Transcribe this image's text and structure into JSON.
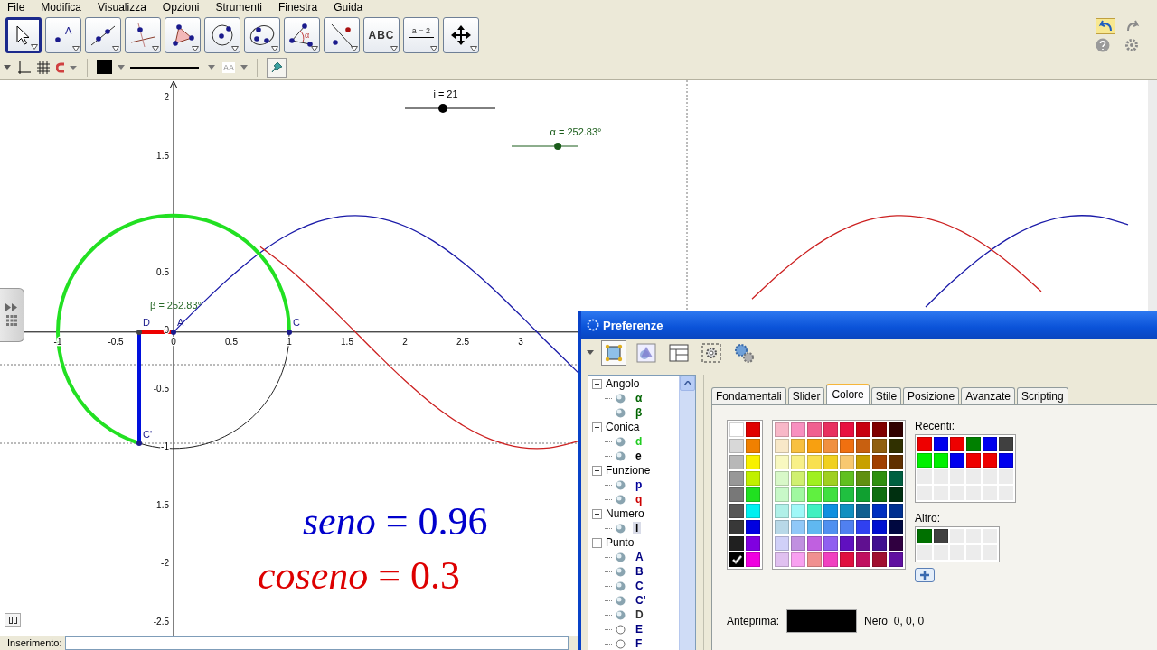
{
  "menu": [
    "File",
    "Modifica",
    "Visualizza",
    "Opzioni",
    "Strumenti",
    "Finestra",
    "Guida"
  ],
  "tools": [
    {
      "kind": "move",
      "selected": true
    },
    {
      "kind": "point",
      "label": "A",
      "selected": false
    },
    {
      "kind": "line",
      "selected": false
    },
    {
      "kind": "perpendicular",
      "selected": false
    },
    {
      "kind": "polygon",
      "selected": false
    },
    {
      "kind": "circle",
      "selected": false
    },
    {
      "kind": "conic",
      "selected": false
    },
    {
      "kind": "angle",
      "label": "α",
      "selected": false
    },
    {
      "kind": "reflect",
      "selected": false
    },
    {
      "kind": "text",
      "label": "ABC",
      "selected": false
    },
    {
      "kind": "slider",
      "label": "a = 2",
      "selected": false
    },
    {
      "kind": "pan",
      "selected": false
    }
  ],
  "style_bar": {
    "label_style": "AA"
  },
  "graphics": {
    "sliders": [
      {
        "label": "i = 21",
        "level": 0.42,
        "color": "#000000"
      },
      {
        "label": "α = 252.83°",
        "level": 0.7,
        "color": "#1a5c1a"
      }
    ],
    "chart_data": {
      "type": "line",
      "x": [
        0,
        0.25,
        0.5,
        0.75,
        1,
        1.25,
        1.5,
        1.75,
        2,
        2.25,
        2.5,
        2.75,
        3,
        3.25,
        3.5,
        3.75,
        4,
        4.25,
        4.5,
        4.75,
        5,
        5.25,
        5.5,
        5.75,
        6,
        6.25,
        6.5,
        6.75,
        7,
        7.25,
        7.5,
        7.75,
        8,
        8.25
      ],
      "series": [
        {
          "color": "#1a1aa8",
          "values": [
            0,
            0.247,
            0.479,
            0.682,
            0.841,
            0.949,
            0.997,
            0.984,
            0.909,
            0.778,
            0.598,
            0.382,
            0.141,
            -0.108,
            -0.351,
            null,
            null,
            null,
            null,
            null,
            null,
            null,
            null,
            null,
            null,
            null,
            0.215,
            0.451,
            0.657,
            0.823,
            0.938,
            0.995,
            0.989,
            0.922
          ]
        },
        {
          "color": "#cc2020",
          "values": [
            null,
            null,
            null,
            0.732,
            0.54,
            0.315,
            0.071,
            -0.178,
            -0.416,
            -0.628,
            -0.801,
            -0.924,
            -0.99,
            -0.994,
            -0.936,
            null,
            null,
            null,
            null,
            null,
            0.284,
            0.512,
            0.709,
            0.861,
            0.96,
            0.999,
            0.977,
            0.893,
            0.754,
            0.568,
            0.347,
            null,
            null,
            null
          ]
        }
      ],
      "xlim": [
        -1.5,
        8.5
      ],
      "ylim": [
        -2.62,
        2.16
      ],
      "xticks": [
        {
          "value": -1,
          "label": "-1"
        },
        {
          "value": -0.5,
          "label": "-0.5"
        },
        {
          "value": 0,
          "label": "0"
        },
        {
          "value": 0.5,
          "label": "0.5"
        },
        {
          "value": 1,
          "label": "1"
        },
        {
          "value": 1.5,
          "label": "1.5"
        },
        {
          "value": 2,
          "label": "2"
        },
        {
          "value": 2.5,
          "label": "2.5"
        },
        {
          "value": 3,
          "label": "3"
        }
      ],
      "yticks": [
        {
          "value": 2,
          "label": "2"
        },
        {
          "value": 1.5,
          "label": "1.5"
        },
        {
          "value": 0.5,
          "label": "0.5"
        },
        {
          "value": 0,
          "label": "0"
        },
        {
          "value": -0.5,
          "label": "-0.5"
        },
        {
          "value": -1,
          "label": "-1"
        },
        {
          "value": -1.5,
          "label": "-1.5"
        },
        {
          "value": -2,
          "label": "-2"
        },
        {
          "value": -2.5,
          "label": "-2.5"
        }
      ]
    },
    "angle_label": "β = 252.83°",
    "points": [
      {
        "label": "D"
      },
      {
        "label": "A"
      },
      {
        "label": "C"
      },
      {
        "label": "C'"
      }
    ],
    "formulas": [
      {
        "text": "*seno* = 0.96",
        "color": "#0000cc"
      },
      {
        "text": "*coseno* = 0.3",
        "color": "#dd0000"
      }
    ]
  },
  "input_bar": {
    "label": "Inserimento:"
  },
  "dialog": {
    "title": "Preferenze",
    "toolbar": [
      {
        "kind": "object",
        "selected": true
      },
      {
        "kind": "graphics",
        "selected": false
      },
      {
        "kind": "layout",
        "selected": false
      },
      {
        "kind": "defaults",
        "selected": false
      },
      {
        "kind": "advanced",
        "selected": false
      }
    ],
    "tree": [
      {
        "label": "Angolo",
        "expanded": true,
        "children": [
          {
            "label": "α",
            "color": "#006400",
            "visible": true,
            "selected": false
          },
          {
            "label": "β",
            "color": "#006400",
            "visible": true,
            "selected": false
          }
        ]
      },
      {
        "label": "Conica",
        "expanded": true,
        "children": [
          {
            "label": "d",
            "color": "#22cc22",
            "visible": true,
            "selected": false
          },
          {
            "label": "e",
            "color": "#000000",
            "visible": true,
            "selected": false
          }
        ]
      },
      {
        "label": "Funzione",
        "expanded": true,
        "children": [
          {
            "label": "p",
            "color": "#000099",
            "visible": true,
            "selected": false
          },
          {
            "label": "q",
            "color": "#cc0000",
            "visible": true,
            "selected": false
          }
        ]
      },
      {
        "label": "Numero",
        "expanded": true,
        "children": [
          {
            "label": "i",
            "color": "#000000",
            "visible": true,
            "selected": true
          }
        ]
      },
      {
        "label": "Punto",
        "expanded": true,
        "children": [
          {
            "label": "A",
            "color": "#000080",
            "visible": true,
            "selected": false
          },
          {
            "label": "B",
            "color": "#000080",
            "visible": true,
            "selected": false
          },
          {
            "label": "C",
            "color": "#000080",
            "visible": true,
            "selected": false
          },
          {
            "label": "C'",
            "color": "#000080",
            "visible": true,
            "selected": false
          },
          {
            "label": "D",
            "color": "#333333",
            "visible": true,
            "selected": false
          },
          {
            "label": "E",
            "color": "#000080",
            "visible": false,
            "selected": false
          },
          {
            "label": "F",
            "color": "#000080",
            "visible": false,
            "selected": false
          }
        ]
      }
    ],
    "tabs": [
      {
        "label": "Fondamentali",
        "selected": false
      },
      {
        "label": "Slider",
        "selected": false
      },
      {
        "label": "Colore",
        "selected": true
      },
      {
        "label": "Stile",
        "selected": false
      },
      {
        "label": "Posizione",
        "selected": false
      },
      {
        "label": "Avanzate",
        "selected": false
      },
      {
        "label": "Scripting",
        "selected": false
      }
    ],
    "palette": {
      "basic": [
        {
          "color": "#ffffff",
          "selected": false
        },
        {
          "color": "#e00000",
          "selected": false
        },
        {
          "color": "#d8d8d8",
          "selected": false
        },
        {
          "color": "#f08000",
          "selected": false
        },
        {
          "color": "#b8b8b8",
          "selected": false
        },
        {
          "color": "#f8f000",
          "selected": false
        },
        {
          "color": "#989898",
          "selected": false
        },
        {
          "color": "#c0f000",
          "selected": false
        },
        {
          "color": "#787878",
          "selected": false
        },
        {
          "color": "#20e020",
          "selected": false
        },
        {
          "color": "#585858",
          "selected": false
        },
        {
          "color": "#00f0f0",
          "selected": false
        },
        {
          "color": "#383838",
          "selected": false
        },
        {
          "color": "#0000e0",
          "selected": false
        },
        {
          "color": "#202020",
          "selected": false
        },
        {
          "color": "#8000e0",
          "selected": false
        },
        {
          "color": "#000000",
          "selected": true
        },
        {
          "color": "#f000e0",
          "selected": false
        }
      ],
      "main": [
        {
          "color": "#f8b8c8"
        },
        {
          "color": "#f890c0"
        },
        {
          "color": "#f06090"
        },
        {
          "color": "#e83060"
        },
        {
          "color": "#e81040"
        },
        {
          "color": "#c80010"
        },
        {
          "color": "#800000"
        },
        {
          "color": "#300000"
        },
        {
          "color": "#f8e8c8"
        },
        {
          "color": "#f8c040"
        },
        {
          "color": "#f8a010"
        },
        {
          "color": "#f09040"
        },
        {
          "color": "#f07010"
        },
        {
          "color": "#c86010"
        },
        {
          "color": "#906010"
        },
        {
          "color": "#303000"
        },
        {
          "color": "#f8f8c0"
        },
        {
          "color": "#f8f088"
        },
        {
          "color": "#f8e050"
        },
        {
          "color": "#f0d020"
        },
        {
          "color": "#f8c870"
        },
        {
          "color": "#c8a000"
        },
        {
          "color": "#a04000"
        },
        {
          "color": "#603000"
        },
        {
          "color": "#d8f8c8"
        },
        {
          "color": "#d0f070"
        },
        {
          "color": "#a0f020"
        },
        {
          "color": "#a0d020"
        },
        {
          "color": "#60c020"
        },
        {
          "color": "#609010"
        },
        {
          "color": "#309010"
        },
        {
          "color": "#006040"
        },
        {
          "color": "#c8f8c8"
        },
        {
          "color": "#a0f8a0"
        },
        {
          "color": "#60f040"
        },
        {
          "color": "#40e040"
        },
        {
          "color": "#20c040"
        },
        {
          "color": "#10a030"
        },
        {
          "color": "#107010"
        },
        {
          "color": "#003010"
        },
        {
          "color": "#b0f0e8"
        },
        {
          "color": "#a0f8f8"
        },
        {
          "color": "#40f0c0"
        },
        {
          "color": "#1090e0"
        },
        {
          "color": "#1090c0"
        },
        {
          "color": "#106090"
        },
        {
          "color": "#0030c0"
        },
        {
          "color": "#003090"
        },
        {
          "color": "#b8d8e8"
        },
        {
          "color": "#90c8f8"
        },
        {
          "color": "#60b8f0"
        },
        {
          "color": "#5090f0"
        },
        {
          "color": "#5080f0"
        },
        {
          "color": "#3040f0"
        },
        {
          "color": "#0010d0"
        },
        {
          "color": "#000840"
        },
        {
          "color": "#d0d0f8"
        },
        {
          "color": "#c090e0"
        },
        {
          "color": "#c060e0"
        },
        {
          "color": "#9060f0"
        },
        {
          "color": "#6010c0"
        },
        {
          "color": "#601090"
        },
        {
          "color": "#401090"
        },
        {
          "color": "#300040"
        },
        {
          "color": "#e0c0f0"
        },
        {
          "color": "#f8a0f0"
        },
        {
          "color": "#f09090"
        },
        {
          "color": "#f040c0"
        },
        {
          "color": "#e01040"
        },
        {
          "color": "#c01060"
        },
        {
          "color": "#a01030"
        },
        {
          "color": "#6010a0"
        }
      ],
      "recent_label": "Recenti:",
      "recent": [
        {
          "kind": "swatch",
          "color": "#ee0000"
        },
        {
          "kind": "swatch",
          "color": "#0000ee"
        },
        {
          "kind": "swatch",
          "color": "#ee0000"
        },
        {
          "kind": "swatch",
          "color": "#008000"
        },
        {
          "kind": "swatch",
          "color": "#0000ee"
        },
        {
          "kind": "swatch",
          "color": "#404040"
        },
        {
          "kind": "swatch",
          "color": "#00f000"
        },
        {
          "kind": "swatch",
          "color": "#00f000"
        },
        {
          "kind": "swatch",
          "color": "#0000ee"
        },
        {
          "kind": "swatch",
          "color": "#ee0000"
        },
        {
          "kind": "swatch",
          "color": "#ee0000"
        },
        {
          "kind": "swatch",
          "color": "#0000ee"
        },
        {
          "kind": "empty"
        },
        {
          "kind": "empty"
        },
        {
          "kind": "empty"
        },
        {
          "kind": "empty"
        },
        {
          "kind": "empty"
        },
        {
          "kind": "empty"
        },
        {
          "kind": "empty"
        },
        {
          "kind": "empty"
        },
        {
          "kind": "empty"
        },
        {
          "kind": "empty"
        },
        {
          "kind": "empty"
        },
        {
          "kind": "empty"
        }
      ],
      "other_label": "Altro:",
      "other": [
        {
          "kind": "swatch",
          "color": "#007000"
        },
        {
          "kind": "swatch",
          "color": "#404040"
        },
        {
          "kind": "empty"
        },
        {
          "kind": "empty"
        },
        {
          "kind": "empty"
        },
        {
          "kind": "empty"
        },
        {
          "kind": "empty"
        },
        {
          "kind": "empty"
        },
        {
          "kind": "empty"
        },
        {
          "kind": "empty"
        }
      ],
      "preview_label": "Anteprima:",
      "preview_name": "Nero  0, 0, 0"
    }
  }
}
